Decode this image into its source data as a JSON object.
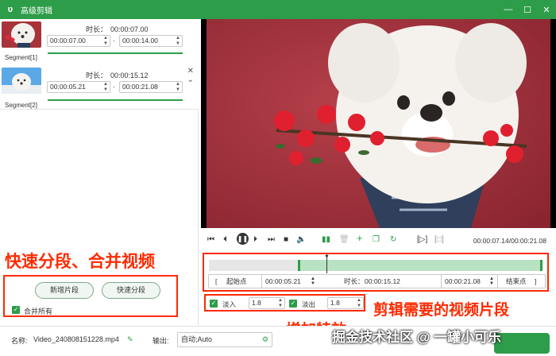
{
  "window": {
    "title": "高级剪辑",
    "app_icon": "rabbit-logo-icon",
    "controls": [
      "minimize-icon",
      "maximize-icon",
      "close-icon"
    ]
  },
  "segments": [
    {
      "label": "Segment[1]",
      "duration_label": "时长：",
      "duration": "00:00:07.00",
      "start": "00:00:07.00",
      "end": "00:00:14.00",
      "selected": false
    },
    {
      "label": "Segment[2]",
      "duration_label": "时长：",
      "duration": "00:00:15.12",
      "start": "00:00:05.21",
      "end": "00:00:21.08",
      "selected": true
    }
  ],
  "left_panel": {
    "annotation": "快速分段、合并视频",
    "add_segment": "新增片段",
    "quick_split": "快速分段",
    "merge_all": "合并所有",
    "merge_checked": true
  },
  "controls": {
    "current_time": "00:00:07.14",
    "total_time": "00:00:21.08",
    "time_sep": "/"
  },
  "timeline": {
    "start_btn": "起始点",
    "start_time": "00:00:05.21",
    "duration_label": "时长：",
    "duration": "00:00:15.12",
    "end_time": "00:00:21.08",
    "end_btn": "结束点",
    "selection_start_fraction": 0.247,
    "selection_end_fraction": 1.0,
    "playhead_fraction": 0.339
  },
  "fades": {
    "fade_in_label": "淡入",
    "fade_in_value": "1.8",
    "fade_in_checked": true,
    "fade_out_label": "淡出",
    "fade_out_value": "1.8",
    "fade_out_checked": true
  },
  "annotations": {
    "clip_needed": "剪辑需要的视频片段",
    "add_effects": "增加特效"
  },
  "bottom": {
    "name_label": "名称:",
    "file_name": "Video_240808151228.mp4",
    "output_label": "输出:",
    "output_value": "自动;Auto"
  },
  "watermark": "掘金技术社区 @ 一罐小可乐",
  "colors": {
    "accent": "#2e9d4a",
    "annotation": "#ff2a00"
  }
}
